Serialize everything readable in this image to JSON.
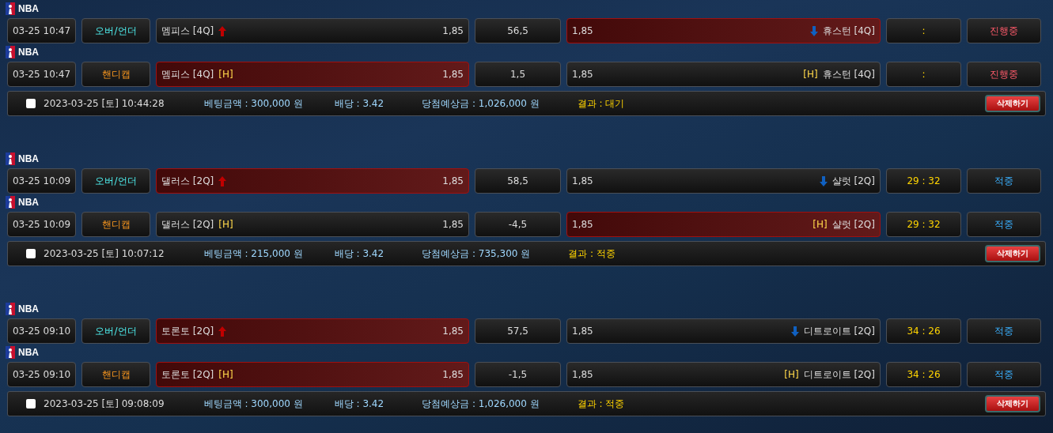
{
  "bets": [
    {
      "games": [
        {
          "league": "NBA",
          "time": "03-25 10:47",
          "kind": "over_under",
          "type": "오버/언더",
          "home": "멤피스 [4Q]",
          "home_odds": "1,85",
          "home_selected": false,
          "line": "56,5",
          "away_odds": "1,85",
          "away": "휴스턴 [4Q]",
          "away_selected": true,
          "score": ":",
          "status": "진행중",
          "in_progress": true
        },
        {
          "league": "NBA",
          "time": "03-25 10:47",
          "kind": "handicap",
          "type": "핸디캡",
          "home": "멤피스 [4Q]",
          "home_tag": "[H]",
          "home_odds": "1,85",
          "home_selected": true,
          "line": "1,5",
          "away_odds": "1,85",
          "away_tag": "[H]",
          "away": "휴스턴 [4Q]",
          "away_selected": false,
          "score": ":",
          "status": "진행중",
          "in_progress": true
        }
      ],
      "summary": {
        "checked": false,
        "datetime": "2023-03-25 [토] 10:44:28",
        "stake": "베팅금액 : 300,000 원",
        "odds": "배당 : 3.42",
        "payout": "당첨예상금 : 1,026,000 원",
        "result": "결과 : 대기",
        "delete": "삭제하기"
      }
    },
    {
      "games": [
        {
          "league": "NBA",
          "time": "03-25 10:09",
          "kind": "over_under",
          "type": "오버/언더",
          "home": "댈러스 [2Q]",
          "home_odds": "1,85",
          "home_selected": true,
          "line": "58,5",
          "away_odds": "1,85",
          "away": "샬럿 [2Q]",
          "away_selected": false,
          "score": "29 : 32",
          "status": "적중",
          "in_progress": false
        },
        {
          "league": "NBA",
          "time": "03-25 10:09",
          "kind": "handicap",
          "type": "핸디캡",
          "home": "댈러스 [2Q]",
          "home_tag": "[H]",
          "home_odds": "1,85",
          "home_selected": false,
          "line": "-4,5",
          "away_odds": "1,85",
          "away_tag": "[H]",
          "away": "샬럿 [2Q]",
          "away_selected": true,
          "score": "29 : 32",
          "status": "적중",
          "in_progress": false
        }
      ],
      "summary": {
        "checked": false,
        "datetime": "2023-03-25 [토] 10:07:12",
        "stake": "베팅금액 : 215,000 원",
        "odds": "배당 : 3.42",
        "payout": "당첨예상금 : 735,300 원",
        "result": "결과 : 적중",
        "delete": "삭제하기"
      }
    },
    {
      "games": [
        {
          "league": "NBA",
          "time": "03-25 09:10",
          "kind": "over_under",
          "type": "오버/언더",
          "home": "토론토 [2Q]",
          "home_odds": "1,85",
          "home_selected": true,
          "line": "57,5",
          "away_odds": "1,85",
          "away": "디트로이트 [2Q]",
          "away_selected": false,
          "score": "34 : 26",
          "status": "적중",
          "in_progress": false
        },
        {
          "league": "NBA",
          "time": "03-25 09:10",
          "kind": "handicap",
          "type": "핸디캡",
          "home": "토론토 [2Q]",
          "home_tag": "[H]",
          "home_odds": "1,85",
          "home_selected": true,
          "line": "-1,5",
          "away_odds": "1,85",
          "away_tag": "[H]",
          "away": "디트로이트 [2Q]",
          "away_selected": false,
          "score": "34 : 26",
          "status": "적중",
          "in_progress": false
        }
      ],
      "summary": {
        "checked": false,
        "datetime": "2023-03-25 [토] 09:08:09",
        "stake": "베팅금액 : 300,000 원",
        "odds": "배당 : 3.42",
        "payout": "당첨예상금 : 1,026,000 원",
        "result": "결과 : 적중",
        "delete": "삭제하기"
      }
    }
  ]
}
